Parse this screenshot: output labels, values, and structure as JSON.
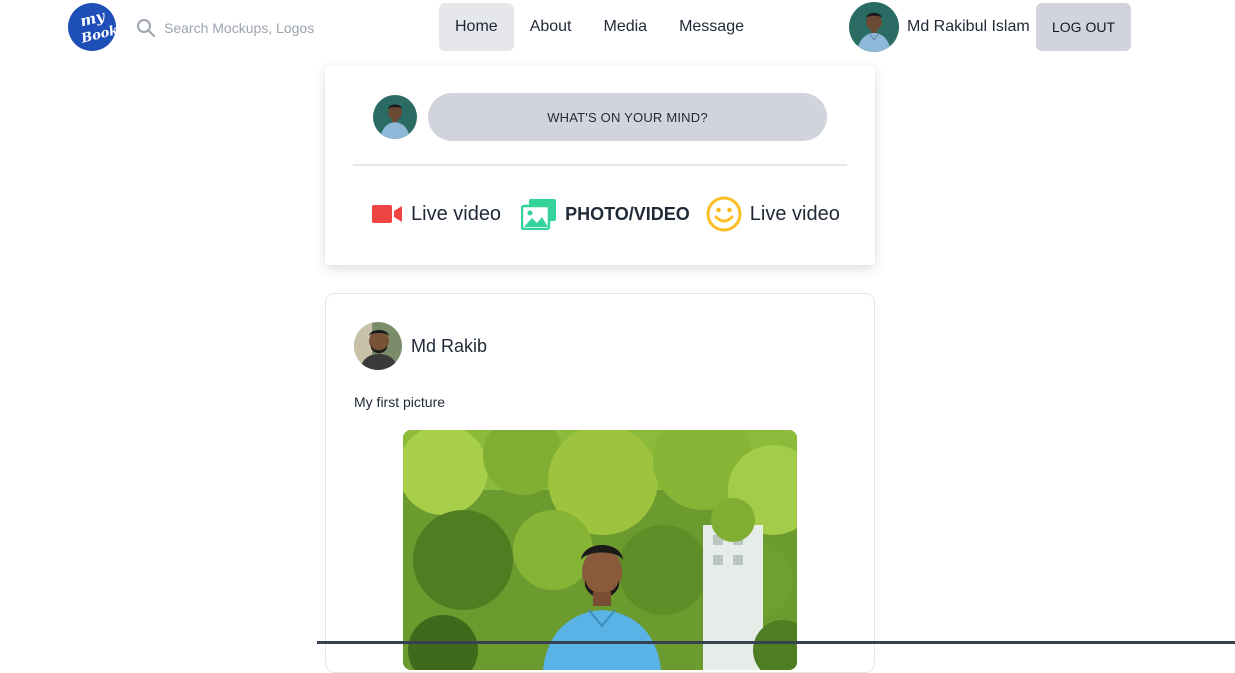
{
  "logo": {
    "text_line1": "my",
    "text_line2": "Book",
    "color": "#1e4fb8"
  },
  "search": {
    "placeholder": "Search Mockups, Logos",
    "value": ""
  },
  "menu": [
    {
      "label": "Home",
      "active": true
    },
    {
      "label": "About",
      "active": false
    },
    {
      "label": "Media",
      "active": false
    },
    {
      "label": "Message",
      "active": false
    }
  ],
  "user": {
    "name": "Md Rakibul Islam",
    "logout_label": "LOG OUT"
  },
  "composer": {
    "prompt_label": "WHAT'S ON YOUR MIND?",
    "actions": [
      {
        "label": "Live video",
        "icon": "video-camera-icon",
        "color": "#ef4444"
      },
      {
        "label": "PHOTO/VIDEO",
        "icon": "photo-gallery-icon",
        "color": "#34d399"
      },
      {
        "label": "Live video",
        "icon": "smiley-face-icon",
        "color": "#fbbf24"
      }
    ]
  },
  "post": {
    "author": "Md Rakib",
    "caption": "My first picture"
  }
}
